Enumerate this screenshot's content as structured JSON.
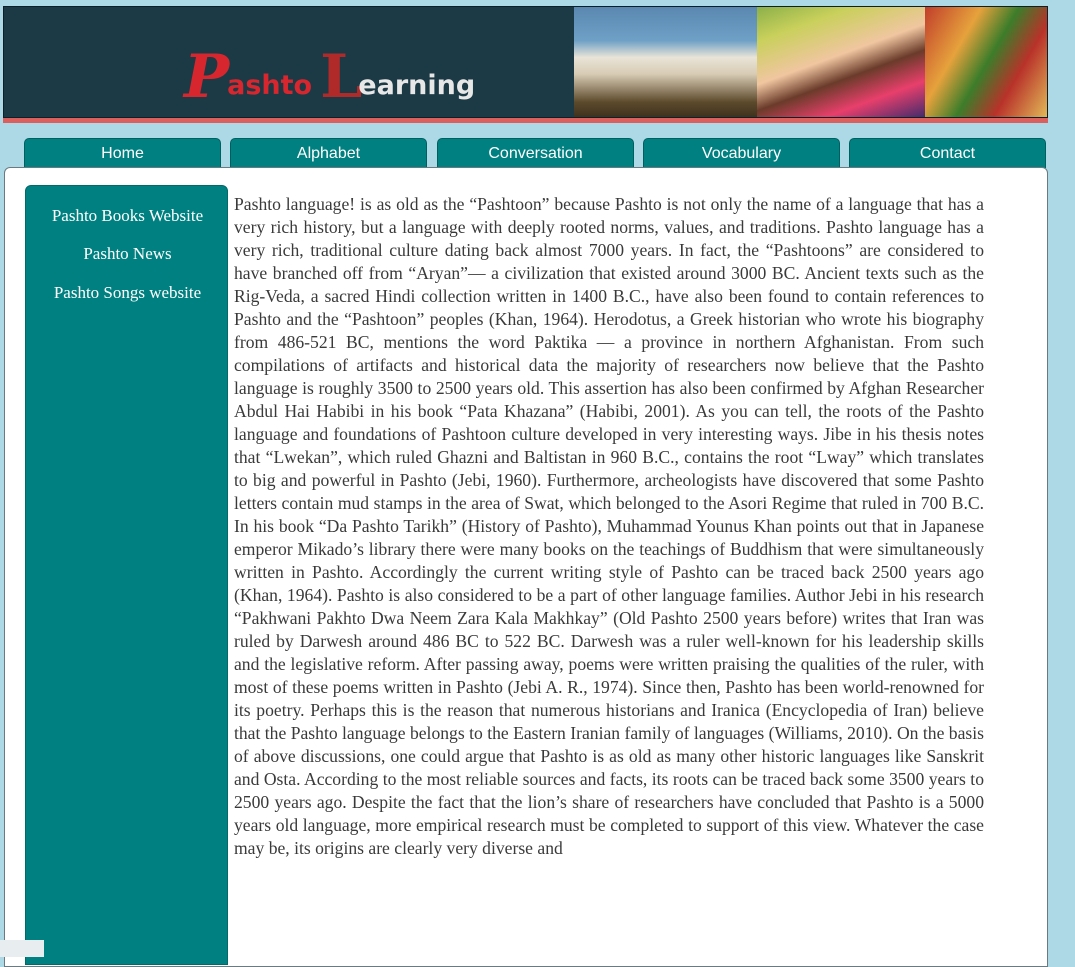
{
  "header": {
    "logo": {
      "big_p": "P",
      "rest_1": "ashto",
      "big_l": "L",
      "rest_2": "earning"
    }
  },
  "nav": {
    "tabs": [
      {
        "label": "Home"
      },
      {
        "label": "Alphabet"
      },
      {
        "label": "Conversation"
      },
      {
        "label": "Vocabulary"
      },
      {
        "label": "Contact"
      }
    ]
  },
  "sidebar": {
    "links": [
      {
        "label": "Pashto Books Website"
      },
      {
        "label": "Pashto News"
      },
      {
        "label": "Pashto Songs website"
      }
    ]
  },
  "main": {
    "article_text": "Pashto language! is as old as the “Pashtoon” because Pashto is not only the name of a language that has a very rich history, but a language with deeply rooted norms, values, and traditions. Pashto language has a very rich, traditional culture dating back almost 7000 years. In fact, the “Pashtoons” are considered to have branched off from “Aryan”— a civilization that existed around 3000 BC. Ancient texts such as the Rig-Veda, a sacred Hindi collection written in 1400 B.C., have also been found to contain references to Pashto and the “Pashtoon” peoples (Khan, 1964). Herodotus, a Greek historian who wrote his biography from 486-521 BC, mentions the word Paktika — a province in northern Afghanistan. From such compilations of artifacts and historical data the majority of researchers now believe that the Pashto language is roughly 3500 to 2500 years old. This assertion has also been confirmed by Afghan Researcher Abdul Hai Habibi in his book “Pata Khazana” (Habibi, 2001). As you can tell, the roots of the Pashto language and foundations of Pashtoon culture developed in very interesting ways. Jibe in his thesis notes that “Lwekan”, which ruled Ghazni and Baltistan in 960 B.C., contains the root “Lway” which translates to big and powerful in Pashto (Jebi, 1960). Furthermore, archeologists have discovered that some Pashto letters contain mud stamps in the area of Swat, which belonged to the Asori Regime that ruled in 700 B.C. In his book “Da Pashto Tarikh” (History of Pashto), Muhammad Younus Khan points out that in Japanese emperor Mikado’s library there were many books on the teachings of Buddhism that were simultaneously written in Pashto. Accordingly the current writing style of Pashto can be traced back 2500 years ago (Khan, 1964). Pashto is also considered to be a part of other language families. Author Jebi in his research “Pakhwani Pakhto Dwa Neem Zara Kala Makhkay” (Old Pashto 2500 years before) writes that Iran was ruled by Darwesh around 486 BC to 522 BC. Darwesh was a ruler well-known for his leadership skills and the legislative reform. After passing away, poems were written praising the qualities of the ruler, with most of these poems written in Pashto (Jebi A. R., 1974). Since then, Pashto has been world-renowned for its poetry. Perhaps this is the reason that numerous historians and Iranica (Encyclopedia of Iran) believe that the Pashto language belongs to the Eastern Iranian family of languages (Williams, 2010). On the basis of above discussions, one could argue that Pashto is as old as many other historic languages like Sanskrit and Osta. According to the most reliable sources and facts, its roots can be traced back some 3500 years to 2500 years ago. Despite the fact that the lion’s share of researchers have concluded that Pashto is a 5000 years old language, more empirical research must be completed to support of this view. Whatever the case may be, its origins are clearly very diverse and"
  },
  "colors": {
    "page_bg": "#add8e6",
    "teal": "#008080",
    "banner_bg": "#1c3a45",
    "stripe": "#d9605c",
    "logo_red": "#d8262e"
  }
}
